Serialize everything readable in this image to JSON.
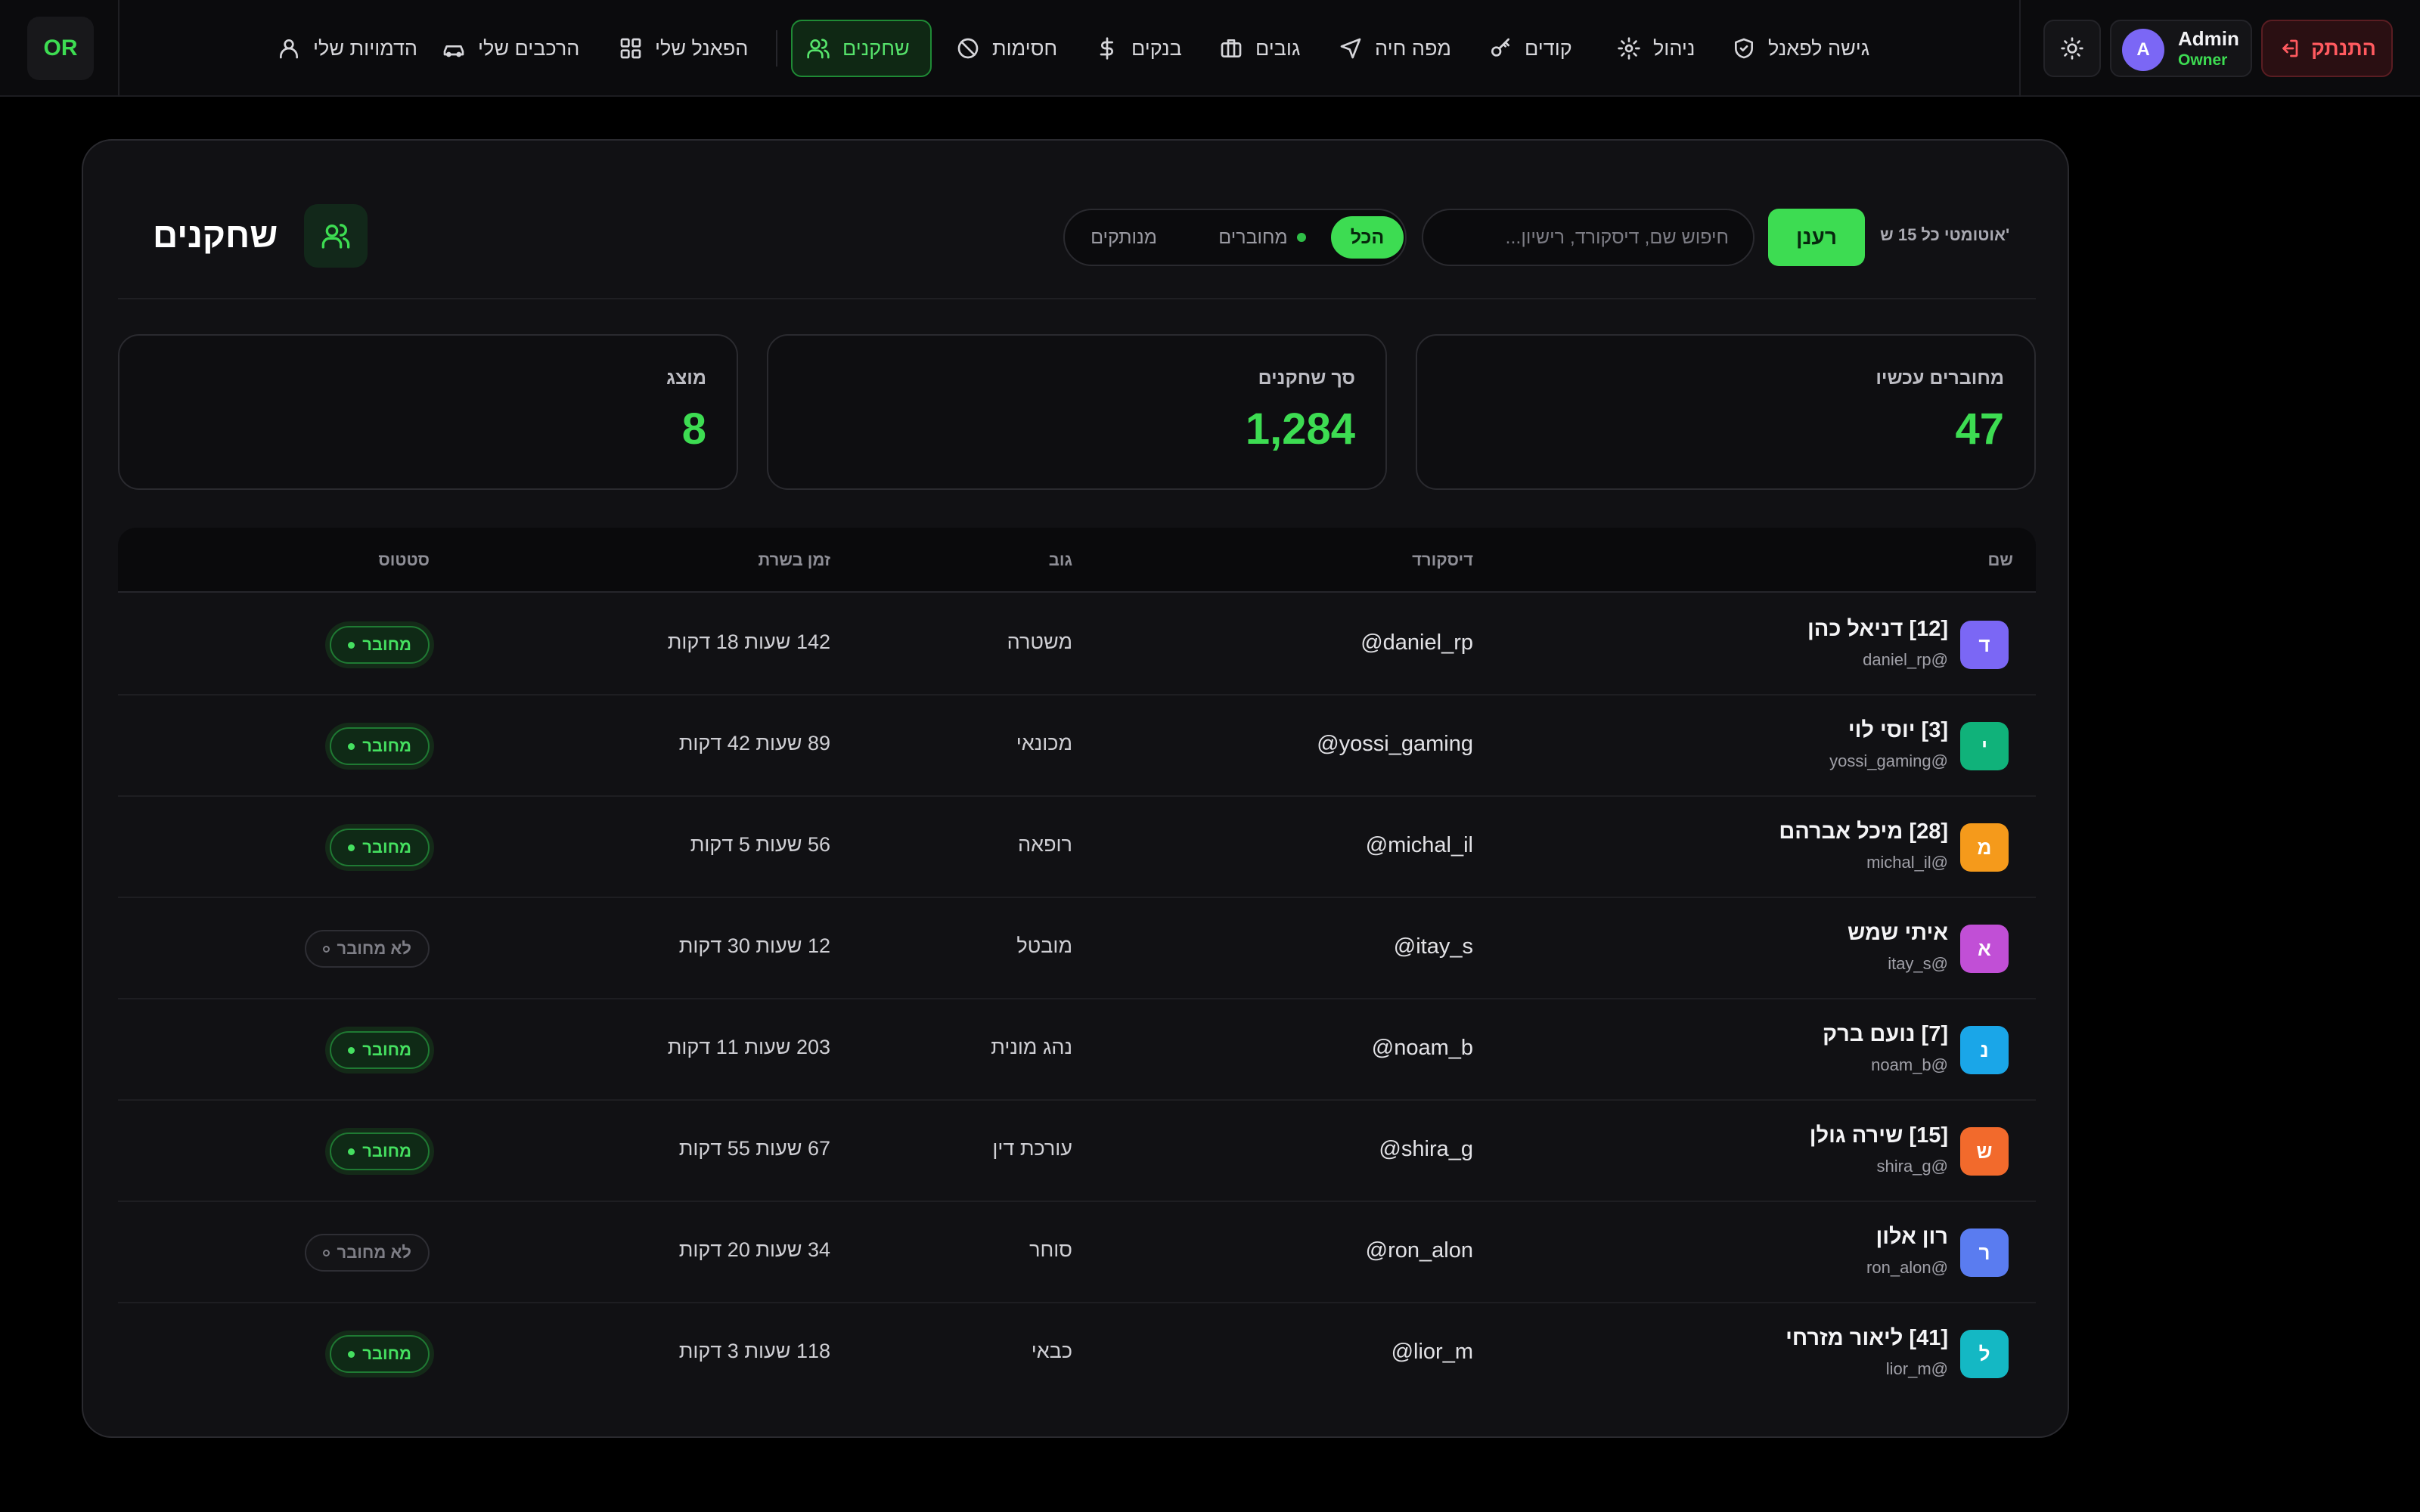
{
  "app": {
    "logo": "OR"
  },
  "nav": [
    {
      "key": "access",
      "label": "גישה לפאנל",
      "icon": "shield-check-icon"
    },
    {
      "key": "manage",
      "label": "ניהול",
      "icon": "gear-icon"
    },
    {
      "key": "codes",
      "label": "קודים",
      "icon": "key-icon"
    },
    {
      "key": "livemap",
      "label": "מפה חיה",
      "icon": "navigation-arrow-icon"
    },
    {
      "key": "gangs",
      "label": "גובים",
      "icon": "briefcase-icon"
    },
    {
      "key": "banks",
      "label": "בנקים",
      "icon": "dollar-icon"
    },
    {
      "key": "bans",
      "label": "חסימות",
      "icon": "ban-icon"
    },
    {
      "key": "players",
      "label": "שחקנים",
      "icon": "users-icon",
      "active": true
    },
    {
      "key": "mypanel",
      "label": "הפאנל שלי",
      "icon": "grid-icon"
    },
    {
      "key": "myvehicles",
      "label": "הרכבים שלי",
      "icon": "car-icon"
    },
    {
      "key": "mycharacters",
      "label": "הדמויות שלי",
      "icon": "user-icon"
    }
  ],
  "user": {
    "initial": "A",
    "name": "Admin",
    "role": "Owner"
  },
  "logout_label": "התנתק",
  "page": {
    "title": "שחקנים",
    "filters": {
      "all": "הכל",
      "online": "מחוברים",
      "offline": "מנותקים",
      "selected": "all"
    },
    "search": {
      "placeholder": "חיפוש שם, דיסקורד, רישיון...",
      "value": ""
    },
    "refresh_label": "רענן",
    "auto_refresh": "אוטומטי כל 15 ש'"
  },
  "stats": [
    {
      "label": "מחוברים עכשיו",
      "value": "47"
    },
    {
      "label": "סך שחקנים",
      "value": "1,284"
    },
    {
      "label": "מוצג",
      "value": "8"
    }
  ],
  "table": {
    "headers": {
      "name": "שם",
      "discord": "דיסקורד",
      "job": "גוב",
      "playtime": "זמן בשרת",
      "status": "סטטוס"
    },
    "status_labels": {
      "online": "מחובר",
      "offline": "לא מחובר"
    },
    "rows": [
      {
        "initial": "ד",
        "name": "[12] דניאל כהן",
        "handle": "daniel_rp@",
        "discord": "daniel_rp@",
        "job": "משטרה",
        "playtime": "142 שעות 18 דקות",
        "status": "online",
        "color": "#7b67f5"
      },
      {
        "initial": "י",
        "name": "[3] יוסי לוי",
        "handle": "yossi_gaming@",
        "discord": "yossi_gaming@",
        "job": "מכונאי",
        "playtime": "89 שעות 42 דקות",
        "status": "online",
        "color": "#10b27a"
      },
      {
        "initial": "מ",
        "name": "[28] מיכל אברהם",
        "handle": "michal_il@",
        "discord": "michal_il@",
        "job": "רופאה",
        "playtime": "56 שעות 5 דקות",
        "status": "online",
        "color": "#f59a1b"
      },
      {
        "initial": "א",
        "name": "איתי שמש",
        "handle": "itay_s@",
        "discord": "itay_s@",
        "job": "מובטל",
        "playtime": "12 שעות 30 דקות",
        "status": "offline",
        "color": "#c14fd6"
      },
      {
        "initial": "נ",
        "name": "[7] נועם ברק",
        "handle": "noam_b@",
        "discord": "noam_b@",
        "job": "נהג מונית",
        "playtime": "203 שעות 11 דקות",
        "status": "online",
        "color": "#1aa6e8"
      },
      {
        "initial": "ש",
        "name": "[15] שירה גולן",
        "handle": "shira_g@",
        "discord": "shira_g@",
        "job": "עורכת דין",
        "playtime": "67 שעות 55 דקות",
        "status": "online",
        "color": "#f26a2c"
      },
      {
        "initial": "ר",
        "name": "רון אלון",
        "handle": "ron_alon@",
        "discord": "ron_alon@",
        "job": "סוחר",
        "playtime": "34 שעות 20 דקות",
        "status": "offline",
        "color": "#5a7cf0"
      },
      {
        "initial": "ל",
        "name": "[41] ליאור מזרחי",
        "handle": "lior_m@",
        "discord": "lior_m@",
        "job": "כבאי",
        "playtime": "118 שעות 3 דקות",
        "status": "online",
        "color": "#14b8c4"
      }
    ]
  }
}
